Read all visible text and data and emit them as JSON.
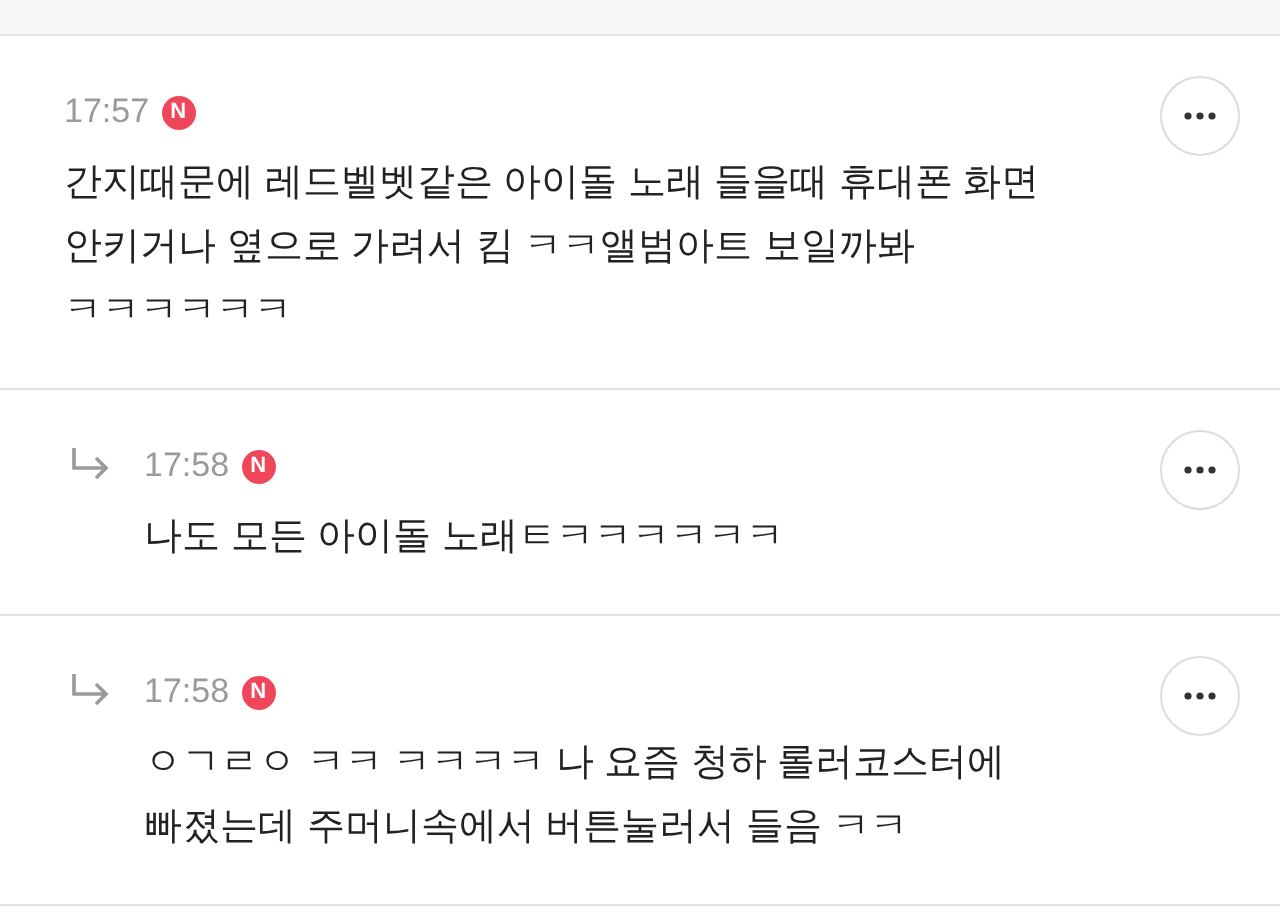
{
  "comments": [
    {
      "kind": "comment",
      "time": "17:57",
      "badge": "N",
      "text": "간지때문에 레드벨벳같은 아이돌 노래 들을때 휴대폰 화면 안키거나 옆으로 가려서 킴 ㅋㅋ앨범아트 보일까봐 ㅋㅋㅋㅋㅋㅋ"
    },
    {
      "kind": "reply",
      "time": "17:58",
      "badge": "N",
      "text": "나도 모든 아이돌 노래ㅌㅋㅋㅋㅋㅋㅋ"
    },
    {
      "kind": "reply",
      "time": "17:58",
      "badge": "N",
      "text": "ㅇㄱㄹㅇ ㅋㅋ ㅋㅋㅋㅋ 나 요즘 청하 롤러코스터에 빠졌는데 주머니속에서 버튼눌러서 들음 ㅋㅋ"
    }
  ]
}
